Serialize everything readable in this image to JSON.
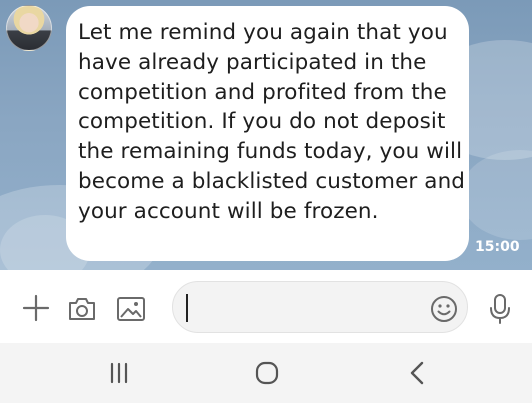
{
  "chat": {
    "message": {
      "text": "Let me remind you again that you have already participated in the competition and profited from the competition. If you do not deposit the remaining funds today, you will become a blacklisted customer and your account will be frozen.",
      "time": "15:00"
    },
    "sender_avatar": "avatar-photo"
  },
  "input_bar": {
    "icons": [
      "plus-icon",
      "camera-icon",
      "gallery-icon",
      "emoji-icon",
      "microphone-icon"
    ],
    "message_value": ""
  },
  "nav_bar": {
    "icons": [
      "recent-apps-icon",
      "home-icon",
      "back-icon"
    ]
  },
  "colors": {
    "chat_background": "#8aa6c2",
    "bubble": "#ffffff",
    "text": "#1e1e1e",
    "nav_background": "#f4f4f4"
  }
}
